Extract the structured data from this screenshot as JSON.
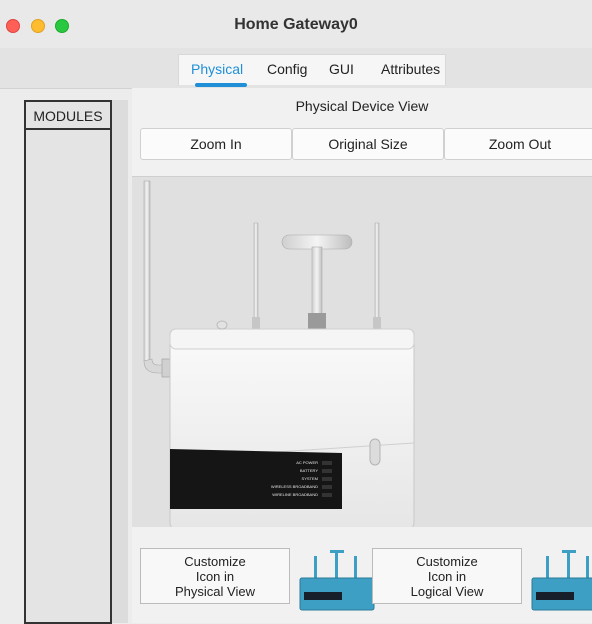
{
  "window": {
    "title": "Home Gateway0"
  },
  "tabs": [
    {
      "label": "Physical",
      "active": true
    },
    {
      "label": "Config",
      "active": false
    },
    {
      "label": "GUI",
      "active": false
    },
    {
      "label": "Attributes",
      "active": false
    }
  ],
  "modules": {
    "label": "MODULES"
  },
  "physical_view": {
    "title": "Physical Device View",
    "zoom_in": "Zoom In",
    "original_size": "Original Size",
    "zoom_out": "Zoom Out"
  },
  "device_leds": [
    "AC POWER",
    "BATTERY",
    "SYSTEM",
    "WIRELESS BROADBAND",
    "WIRELINE BROADBAND"
  ],
  "customize": {
    "physical": "Customize\nIcon in\nPhysical View",
    "logical": "Customize\nIcon in\nLogical View"
  },
  "colors": {
    "accent": "#1f8fd8",
    "device_icon": "#3d9fc4"
  }
}
